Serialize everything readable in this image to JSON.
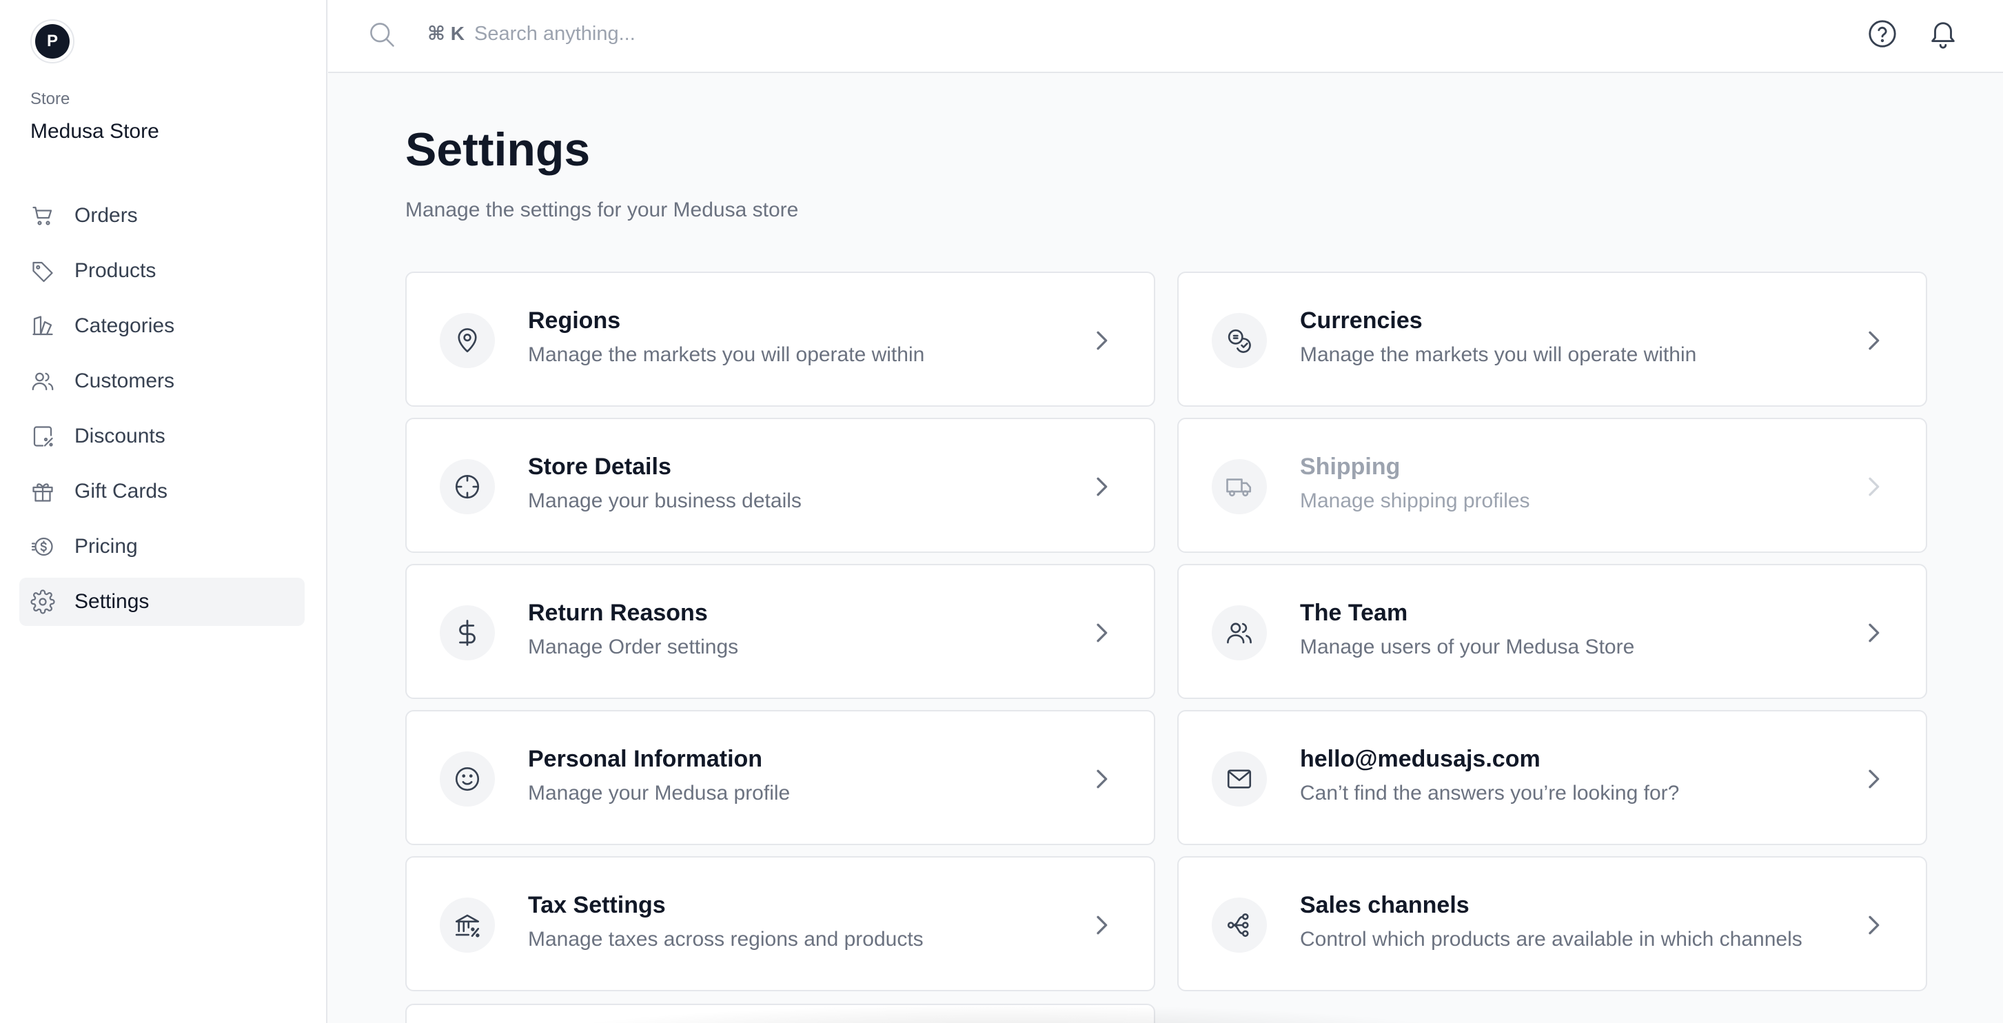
{
  "store": {
    "avatar_initial": "P",
    "label": "Store",
    "name": "Medusa Store"
  },
  "sidebar": {
    "items": [
      {
        "label": "Orders",
        "icon": "cart-icon",
        "active": false
      },
      {
        "label": "Products",
        "icon": "tag-icon",
        "active": false
      },
      {
        "label": "Categories",
        "icon": "categories-icon",
        "active": false
      },
      {
        "label": "Customers",
        "icon": "users-icon",
        "active": false
      },
      {
        "label": "Discounts",
        "icon": "discount-icon",
        "active": false
      },
      {
        "label": "Gift Cards",
        "icon": "gift-icon",
        "active": false
      },
      {
        "label": "Pricing",
        "icon": "pricing-icon",
        "active": false
      },
      {
        "label": "Settings",
        "icon": "gear-icon",
        "active": true
      }
    ]
  },
  "topbar": {
    "shortcut": "⌘ K",
    "search_placeholder": "Search anything...",
    "help_icon": "help-circle-icon",
    "notifications_icon": "bell-icon"
  },
  "main": {
    "title": "Settings",
    "subtitle": "Manage the settings for your Medusa store",
    "cards": [
      {
        "title": "Regions",
        "description": "Manage the markets you will operate within",
        "icon": "map-pin-icon",
        "disabled": false
      },
      {
        "title": "Currencies",
        "description": "Manage the markets you will operate within",
        "icon": "coins-icon",
        "disabled": false
      },
      {
        "title": "Store Details",
        "description": "Manage your business details",
        "icon": "crosshair-icon",
        "disabled": false
      },
      {
        "title": "Shipping",
        "description": "Manage shipping profiles",
        "icon": "truck-icon",
        "disabled": true
      },
      {
        "title": "Return Reasons",
        "description": "Manage Order settings",
        "icon": "dollar-icon",
        "disabled": false
      },
      {
        "title": "The Team",
        "description": "Manage users of your Medusa Store",
        "icon": "users-icon",
        "disabled": false
      },
      {
        "title": "Personal Information",
        "description": "Manage your Medusa profile",
        "icon": "smile-icon",
        "disabled": false
      },
      {
        "title": "hello@medusajs.com",
        "description": "Can’t find the answers you’re looking for?",
        "icon": "mail-icon",
        "disabled": false
      },
      {
        "title": "Tax Settings",
        "description": "Manage taxes across regions and products",
        "icon": "bank-percent-icon",
        "disabled": false
      },
      {
        "title": "Sales channels",
        "description": "Control which products are available in which channels",
        "icon": "channels-icon",
        "disabled": false
      }
    ]
  },
  "colors": {
    "background": "#f9fafb",
    "surface": "#ffffff",
    "border": "#e5e7eb",
    "text_primary": "#111827",
    "text_secondary": "#6b7280",
    "text_disabled": "#9ca3af",
    "active_nav_bg": "#f3f4f6"
  }
}
